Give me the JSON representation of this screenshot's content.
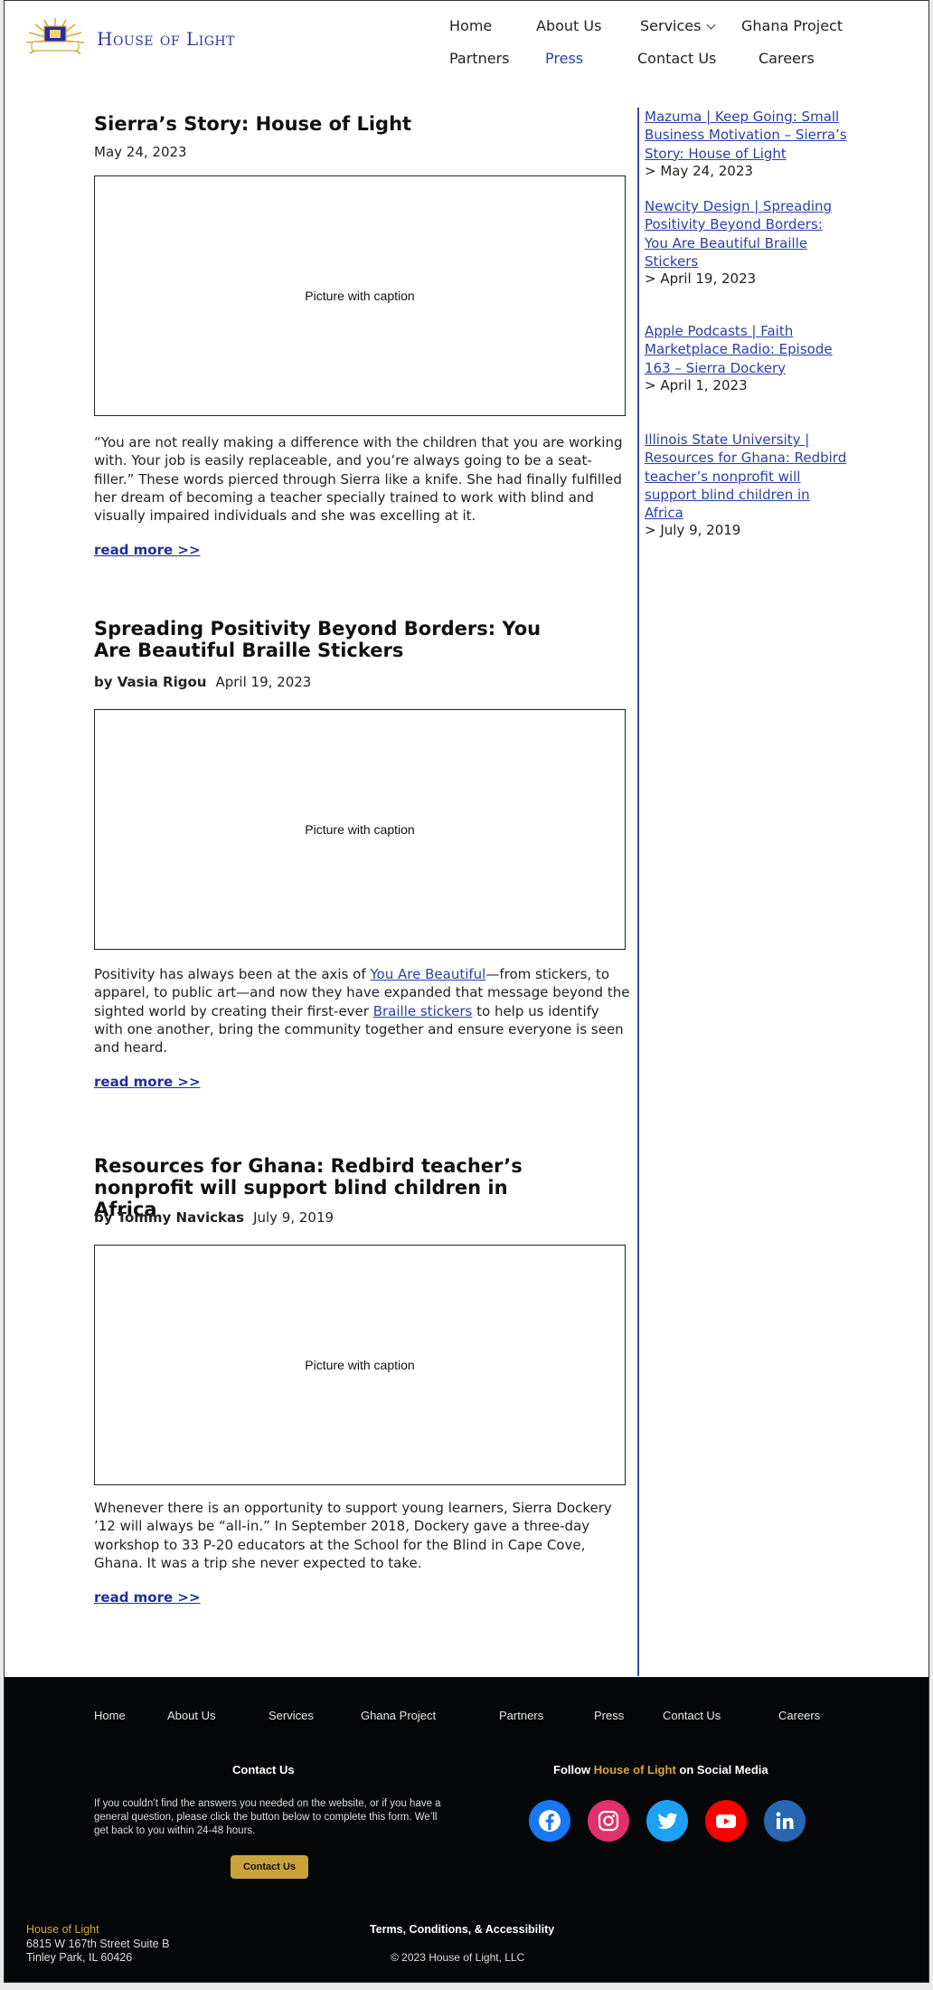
{
  "header": {
    "brand": "House of Light",
    "logo_text": "HOUSE OF LIGHT",
    "nav": {
      "home": "Home",
      "about": "About Us",
      "services": "Services",
      "ghana": "Ghana Project",
      "partners": "Partners",
      "press": "Press",
      "contact": "Contact Us",
      "careers": "Careers"
    }
  },
  "articles": [
    {
      "title": "Sierra’s Story: House of Light",
      "author": "",
      "date": "May 24, 2023",
      "image_caption": "Picture with caption",
      "excerpt": "“You are not really making a difference with the children that you are working with. Your job is easily replaceable, and you’re always going to be a seat-filler.” These words pierced through Sierra like a knife. She had finally fulfilled her dream of becoming a teacher specially trained to work with blind and visually impaired individuals and she was excelling at it.",
      "read_more": "read more >>"
    },
    {
      "title": "Spreading Positivity Beyond Borders: You Are Beautiful Braille Stickers",
      "author": "by Vasia Rigou",
      "date": "April 19, 2023",
      "image_caption": "Picture with caption",
      "excerpt_pre": "Positivity has always been at the axis of ",
      "excerpt_link1": "You Are Beautiful",
      "excerpt_mid": "—from stickers, to apparel, to public art—and now they have expanded that message beyond the sighted world by creating their first-ever ",
      "excerpt_link2": "Braille stickers",
      "excerpt_post": " to help us identify with one another, bring the community together and ensure everyone is seen and heard.",
      "read_more": "read more >>"
    },
    {
      "title": "Resources for Ghana: Redbird teacher’s nonprofit will support blind children in Africa",
      "author": "by Tommy Navickas",
      "date": "July 9, 2019",
      "image_caption": "Picture with caption",
      "excerpt": "Whenever there is an opportunity to support young learners, Sierra Dockery ’12 will always be “all-in.” In September 2018, Dockery gave a three-day workshop to 33 P-20 educators at the School for the Blind in Cape Cove, Ghana. It was a trip she never expected to take.",
      "read_more": "read more >>"
    }
  ],
  "sidebar": [
    {
      "link": "Mazuma | Keep Going: Small Business Motivation – Sierra’s Story: House of Light",
      "date": "> May 24, 2023"
    },
    {
      "link": "Newcity Design | Spreading Positivity Beyond Borders: You Are Beautiful Braille Stickers",
      "date": "> April 19, 2023"
    },
    {
      "link": "Apple Podcasts | Faith Marketplace Radio: Episode 163 – Sierra Dockery",
      "date": "> April 1, 2023"
    },
    {
      "link": "Illinois State University | Resources for Ghana: Redbird teacher’s nonprofit will support blind children in Africa",
      "date": "> July 9, 2019"
    }
  ],
  "footer": {
    "nav": {
      "home": "Home",
      "about": "About Us",
      "services": "Services",
      "ghana": "Ghana Project",
      "partners": "Partners",
      "press": "Press",
      "contact": "Contact Us",
      "careers": "Careers"
    },
    "contact_heading": "Contact Us",
    "contact_text": "If you couldn’t find the answers you needed on the website, or if you have a general question, please click the button below to complete this form.  We’ll get back to you within 24-48 hours.",
    "contact_button": "Contact Us",
    "follow_pre": "Follow ",
    "follow_brand": "House of Light",
    "follow_post": " on Social Media",
    "social": [
      {
        "icon": "facebook-icon",
        "color": "#1877f2"
      },
      {
        "icon": "instagram-icon",
        "color": "#e1306c"
      },
      {
        "icon": "twitter-icon",
        "color": "#1da1f2"
      },
      {
        "icon": "youtube-icon",
        "color": "#ff0000"
      },
      {
        "icon": "linkedin-icon",
        "color": "#2867b2"
      }
    ],
    "address_name": "House of Light",
    "address_line1": "6815 W 167th Street Suite B",
    "address_line2": "Tinley Park, IL 60426",
    "terms": "Terms, Conditions, & Accessibility",
    "copyright": "© 2023 House of Light, LLC"
  }
}
